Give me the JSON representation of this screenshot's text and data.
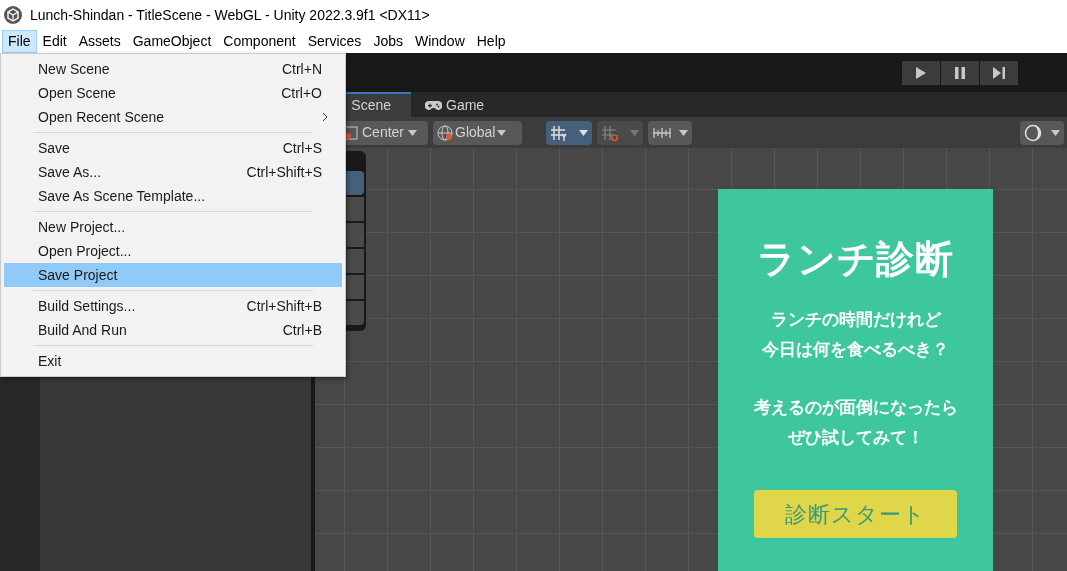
{
  "window": {
    "title": "Lunch-Shindan - TitleScene - WebGL - Unity 2022.3.9f1 <DX11>"
  },
  "menubar": [
    {
      "label": "File",
      "selected": true
    },
    {
      "label": "Edit",
      "selected": false
    },
    {
      "label": "Assets",
      "selected": false
    },
    {
      "label": "GameObject",
      "selected": false
    },
    {
      "label": "Component",
      "selected": false
    },
    {
      "label": "Services",
      "selected": false
    },
    {
      "label": "Jobs",
      "selected": false
    },
    {
      "label": "Window",
      "selected": false
    },
    {
      "label": "Help",
      "selected": false
    }
  ],
  "file_menu": [
    [
      {
        "label": "New Scene",
        "shortcut": "Ctrl+N",
        "selected": false
      },
      {
        "label": "Open Scene",
        "shortcut": "Ctrl+O",
        "selected": false
      },
      {
        "label": "Open Recent Scene",
        "submenu": true,
        "selected": false
      }
    ],
    [
      {
        "label": "Save",
        "shortcut": "Ctrl+S",
        "selected": false
      },
      {
        "label": "Save As...",
        "shortcut": "Ctrl+Shift+S",
        "selected": false
      },
      {
        "label": "Save As Scene Template...",
        "selected": false
      }
    ],
    [
      {
        "label": "New Project...",
        "selected": false
      },
      {
        "label": "Open Project...",
        "selected": false
      },
      {
        "label": "Save Project",
        "selected": true
      }
    ],
    [
      {
        "label": "Build Settings...",
        "shortcut": "Ctrl+Shift+B",
        "selected": false
      },
      {
        "label": "Build And Run",
        "shortcut": "Ctrl+B",
        "selected": false
      }
    ],
    [
      {
        "label": "Exit",
        "selected": false
      }
    ]
  ],
  "view_tabs": [
    {
      "label": "Scene",
      "kind": "scene",
      "selected": true
    },
    {
      "label": "Game",
      "kind": "game",
      "selected": false
    }
  ],
  "scene_toolbar": {
    "pivot": "Center",
    "space": "Global",
    "grid_snapping": true
  },
  "game_canvas": {
    "title": "ランチ診断",
    "paragraphs": [
      [
        "ランチの時間だけれど",
        "今日は何を食べるべき？"
      ],
      [
        "考えるのが面倒になったら",
        "ぜひ試してみて！"
      ]
    ],
    "start_button": "診断スタート"
  }
}
